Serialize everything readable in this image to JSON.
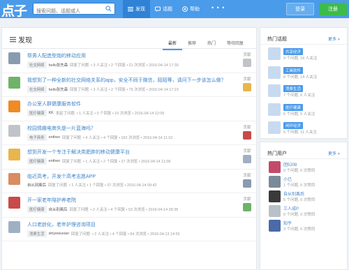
{
  "header": {
    "logo": "点子",
    "search_placeholder": "搜索问题、话题或人",
    "nav": [
      {
        "label": "发现",
        "icon": "list-icon",
        "active": true
      },
      {
        "label": "话题",
        "icon": "chat-icon",
        "active": false
      },
      {
        "label": "帮助",
        "icon": "help-icon",
        "active": false
      }
    ],
    "more": "• • •",
    "login": "登录",
    "register": "注册"
  },
  "main": {
    "title": "发现",
    "tabs": [
      "最新",
      "推荐",
      "热门",
      "等待回复"
    ],
    "contrib_label": "贡献",
    "items": [
      {
        "title": "帮男人配造型炮的移动应用",
        "tag": "社交网络",
        "author": "hello张先森",
        "action": "回复了问题",
        "stats": "• 3 人关注 • 2 个回复 • 21 次浏览 • 2016-04-14 17:30",
        "has_contrib": true
      },
      {
        "title": "我想到了一种全新的社交网络关系的app，安全不同于微信，陌陌等，请问下一步该怎么做？",
        "tag": "社交网络",
        "author": "hello张先森",
        "action": "回复了问题",
        "stats": "• 3 人关注 • 2 个回复 • 79 次浏览 • 2016-04-14 17:23",
        "has_contrib": true
      },
      {
        "title": "办公室人群健康服务软件",
        "tag": "医疗健康",
        "author": "KK",
        "action": "发起了问题",
        "stats": "• 1 人关注 • 0 个回复 • 10 次浏览 • 2016-04-14 12:05",
        "has_contrib": false
      },
      {
        "title": "校园情趣电商失是一片蓝海吗？",
        "tag": "电子商务",
        "author": "entheo",
        "action": "回复了问题",
        "stats": "• 4 人关注 • 4 个回复 • 162 次浏览 • 2016-04-14 11:10",
        "has_contrib": true
      },
      {
        "title": "想到开发一个专注于解决类肥胖的移动健康平台",
        "tag": "医疗健康",
        "author": "entheo",
        "action": "回复了问题",
        "stats": "• 1 人关注 • 2 个回复 • 27 次浏览 • 2016-04-14 11:08",
        "has_contrib": true
      },
      {
        "title": "临近高考，开发个高考志愿APP",
        "tag": "",
        "author": "自从别离后",
        "action": "回复了问题",
        "stats": "• 1 人关注 • 1 个回复 • 37 次浏览 • 2016-04-14 09:42",
        "has_contrib": true
      },
      {
        "title": "开一家老年陪护养老院",
        "tag": "医疗健康",
        "author": "自从别离后",
        "action": "回复了问题",
        "stats": "• 2 人关注 • 4 个回复 • 53 次浏览 • 2016-04-14 09:38",
        "has_contrib": true
      },
      {
        "title": "人口老龄化，老年护理咨询项目",
        "tag": "消费生活",
        "author": "shiyewuxian",
        "action": "回复了问题",
        "stats": "• 2 人关注 • 4 个回复 • 64 次浏览 • 2016-04-13 14:55",
        "has_contrib": false
      }
    ]
  },
  "sidebar": {
    "topics_title": "热门话题",
    "more": "更多 »",
    "topics": [
      {
        "name": "共享经济",
        "stats": "9 个问题, 16 人关注"
      },
      {
        "name": "工具软件",
        "stats": "8 个问题, 14 人关注"
      },
      {
        "name": "消费生活",
        "stats": "7 个问题, 6 人关注"
      },
      {
        "name": "医疗健康",
        "stats": "6 个问题, 5 人关注"
      },
      {
        "name": "闲环经济",
        "stats": "5 个问题, 11 人关注"
      }
    ],
    "users_title": "热门用户",
    "users": [
      {
        "name": "团5208",
        "stats": "0 个问题, 0 次赞同"
      },
      {
        "name": "小已",
        "stats": "1 个问题, 0 次赞同"
      },
      {
        "name": "自从别离后",
        "stats": "5 个问题, 0 次赞同"
      },
      {
        "name": "三人成P",
        "stats": "0 个问题, 0 次赞同"
      },
      {
        "name": "知乎",
        "stats": "3 个问题, 0 次赞同"
      }
    ]
  }
}
